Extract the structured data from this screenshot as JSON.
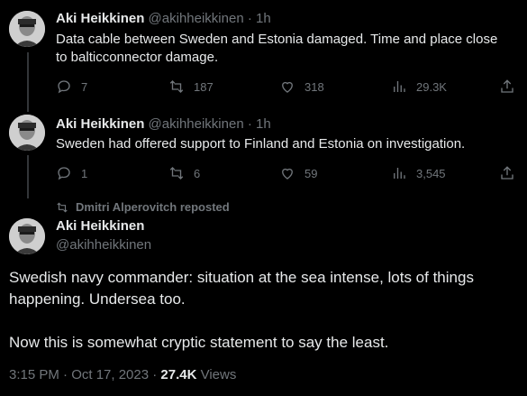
{
  "tweets": [
    {
      "name": "Aki Heikkinen",
      "handle": "@akihheikkinen",
      "time": "· 1h",
      "text": "Data cable between Sweden and Estonia damaged. Time and place close to balticconnector damage.",
      "replies": "7",
      "reposts": "187",
      "likes": "318",
      "views": "29.3K"
    },
    {
      "name": "Aki Heikkinen",
      "handle": "@akihheikkinen",
      "time": "· 1h",
      "text": "Sweden had offered support to Finland and Estonia on investigation.",
      "replies": "1",
      "reposts": "6",
      "likes": "59",
      "views": "3,545"
    }
  ],
  "main": {
    "reposted_by": "Dmitri Alperovitch reposted",
    "name": "Aki Heikkinen",
    "handle": "@akihheikkinen",
    "paragraph1": "Swedish navy commander: situation at the sea intense, lots of things happening. Undersea too.",
    "paragraph2": "Now this is somewhat cryptic statement to say the least.",
    "timestamp": "3:15 PM · Oct 17, 2023 · ",
    "views_count": "27.4K",
    "views_label": " Views"
  },
  "icons": {
    "reply": "reply-icon",
    "repost": "repost-icon",
    "like": "heart-icon",
    "views": "views-icon",
    "share": "share-icon"
  },
  "colors": {
    "background": "#000000",
    "text": "#e7e9ea",
    "secondary": "#71767b"
  }
}
